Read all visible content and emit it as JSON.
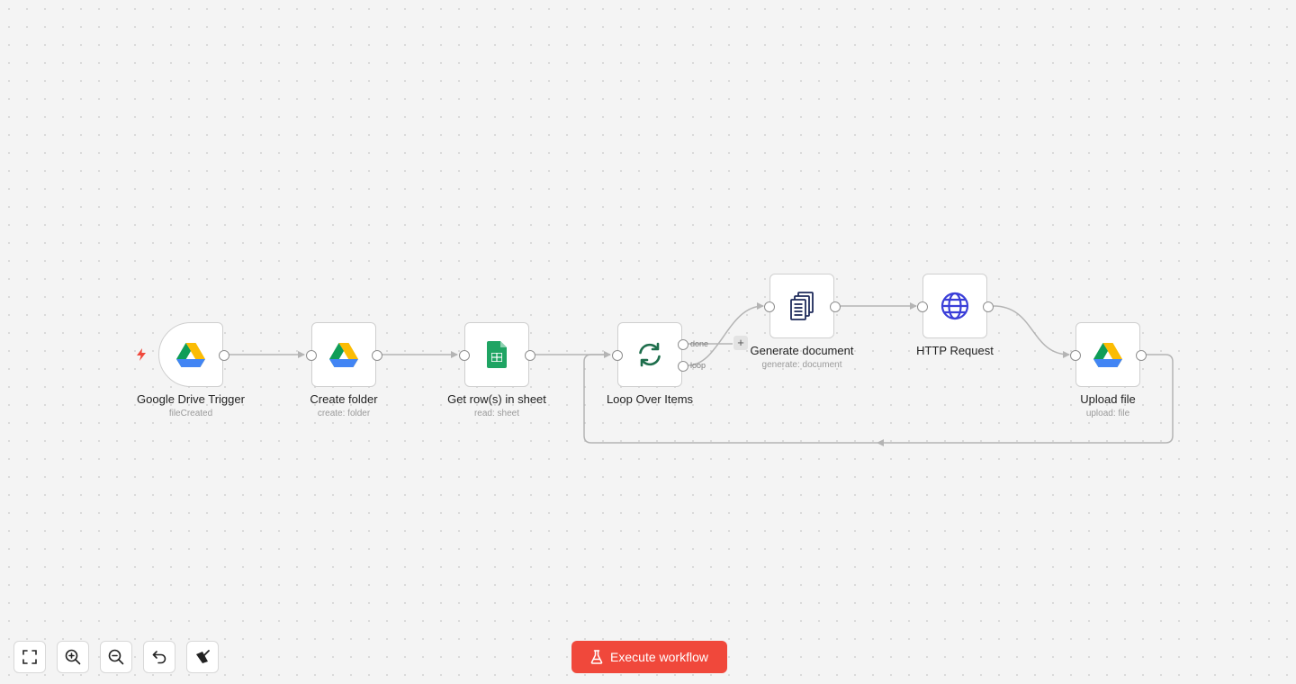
{
  "colors": {
    "accent": "#f0483b",
    "canvas_bg": "#f4f4f4",
    "edge": "#b4b4b4",
    "sheets_green": "#1fa463",
    "loop_green": "#1e6e4c",
    "http_blue": "#3b3fd8",
    "doc_navy": "#1f2b5b",
    "trigger_bolt": "#f0483b"
  },
  "nodes": [
    {
      "id": "drive-trigger",
      "label": "Google Drive Trigger",
      "subtitle": "fileCreated",
      "icon": "google-drive-icon"
    },
    {
      "id": "create-folder",
      "label": "Create folder",
      "subtitle": "create: folder",
      "icon": "google-drive-icon"
    },
    {
      "id": "get-rows",
      "label": "Get row(s) in sheet",
      "subtitle": "read: sheet",
      "icon": "google-sheets-icon"
    },
    {
      "id": "loop-over-items",
      "label": "Loop Over Items",
      "subtitle": "",
      "icon": "loop-arrows-icon",
      "outputs": [
        "done",
        "loop"
      ]
    },
    {
      "id": "generate-document",
      "label": "Generate document",
      "subtitle": "generate: document",
      "icon": "documents-icon"
    },
    {
      "id": "http-request",
      "label": "HTTP Request",
      "subtitle": "",
      "icon": "globe-icon"
    },
    {
      "id": "upload-file",
      "label": "Upload file",
      "subtitle": "upload: file",
      "icon": "google-drive-icon"
    }
  ],
  "connector": {
    "add_symbol": "+"
  },
  "toolbar": [
    {
      "id": "fit-view",
      "icon": "fit-view-icon"
    },
    {
      "id": "zoom-in",
      "icon": "zoom-in-icon"
    },
    {
      "id": "zoom-out",
      "icon": "zoom-out-icon"
    },
    {
      "id": "undo",
      "icon": "undo-icon"
    },
    {
      "id": "tidy-up",
      "icon": "broom-icon"
    }
  ],
  "execute": {
    "label": "Execute workflow",
    "icon": "flask-icon"
  }
}
